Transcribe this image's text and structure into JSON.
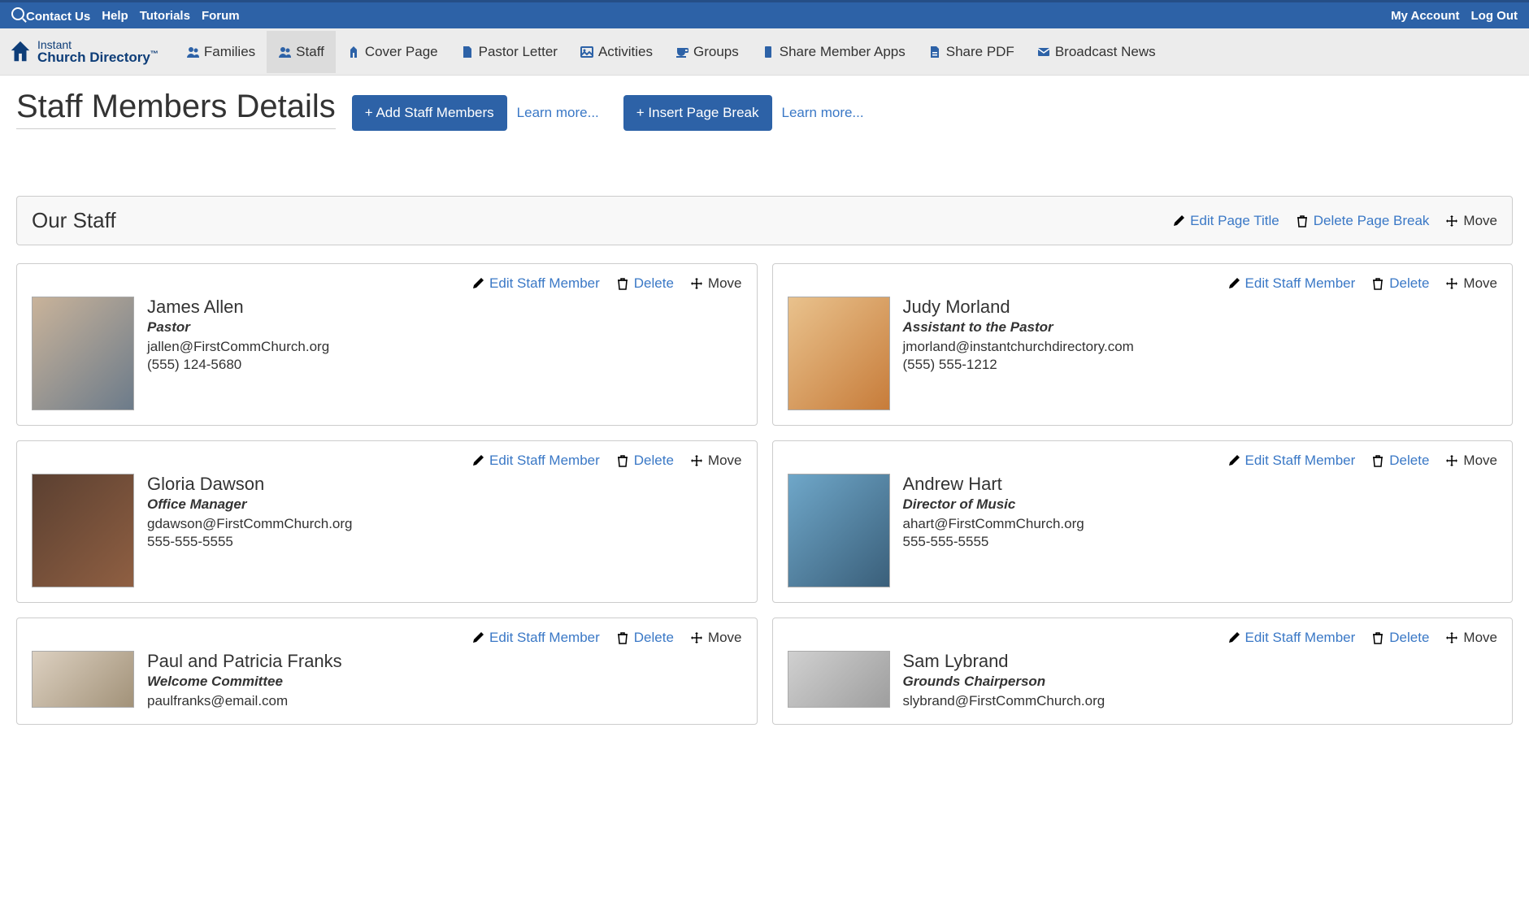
{
  "topbar": {
    "left": [
      "Contact Us",
      "Help",
      "Tutorials",
      "Forum"
    ],
    "right": [
      "My Account",
      "Log Out"
    ]
  },
  "logo": {
    "line1": "Instant",
    "line2": "Church Directory",
    "tm": "™"
  },
  "nav": [
    {
      "label": "Families",
      "icon": "users"
    },
    {
      "label": "Staff",
      "icon": "users",
      "active": true
    },
    {
      "label": "Cover Page",
      "icon": "church"
    },
    {
      "label": "Pastor Letter",
      "icon": "file"
    },
    {
      "label": "Activities",
      "icon": "image"
    },
    {
      "label": "Groups",
      "icon": "cup"
    },
    {
      "label": "Share Member Apps",
      "icon": "phone"
    },
    {
      "label": "Share PDF",
      "icon": "pdf"
    },
    {
      "label": "Broadcast News",
      "icon": "envelope"
    }
  ],
  "page": {
    "title": "Staff Members Details",
    "add_btn": "+ Add Staff Members",
    "learn_more_1": "Learn more...",
    "insert_break_btn": "+ Insert Page Break",
    "learn_more_2": "Learn more..."
  },
  "section": {
    "title": "Our Staff",
    "edit_title": "Edit Page Title",
    "delete_break": "Delete Page Break",
    "move": "Move"
  },
  "card_actions": {
    "edit": "Edit Staff Member",
    "delete": "Delete",
    "move": "Move"
  },
  "staff": [
    {
      "name": "James Allen",
      "role": "Pastor",
      "email": "jallen@FirstCommChurch.org",
      "phone": "(555) 124-5680",
      "avatar": "v1"
    },
    {
      "name": "Judy Morland",
      "role": "Assistant to the Pastor",
      "email": "jmorland@instantchurchdirectory.com",
      "phone": "(555) 555-1212",
      "avatar": "v2"
    },
    {
      "name": "Gloria Dawson",
      "role": "Office Manager",
      "email": "gdawson@FirstCommChurch.org",
      "phone": "555-555-5555",
      "avatar": "v3"
    },
    {
      "name": "Andrew Hart",
      "role": "Director of Music",
      "email": "ahart@FirstCommChurch.org",
      "phone": "555-555-5555",
      "avatar": "v4"
    },
    {
      "name": "Paul and Patricia Franks",
      "role": "Welcome Committee",
      "email": "paulfranks@email.com",
      "phone": "",
      "avatar": "v5",
      "short": true
    },
    {
      "name": "Sam Lybrand",
      "role": "Grounds Chairperson",
      "email": "slybrand@FirstCommChurch.org",
      "phone": "",
      "avatar": "v6",
      "short": true
    }
  ]
}
